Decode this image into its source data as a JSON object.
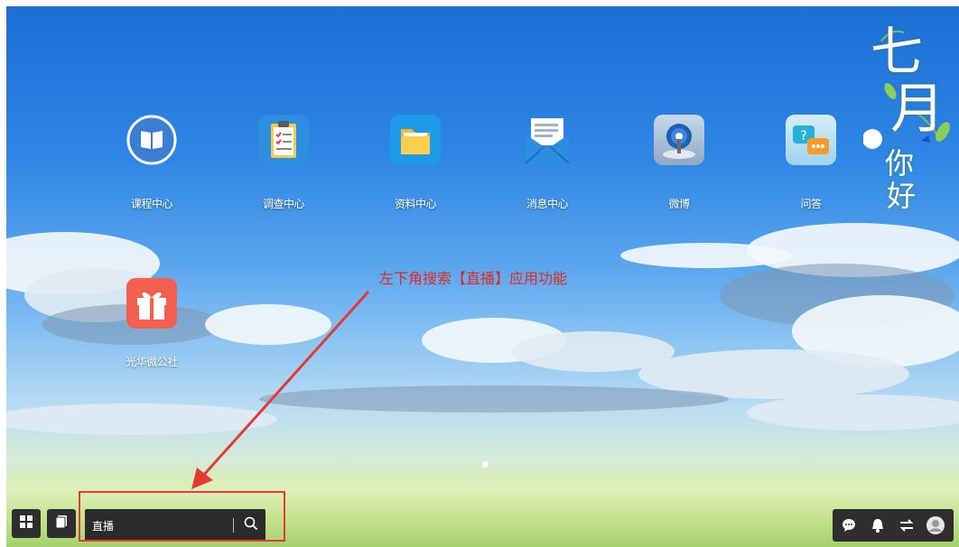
{
  "apps": [
    {
      "label": "课程中心",
      "icon": "book-icon"
    },
    {
      "label": "调查中心",
      "icon": "clipboard-icon"
    },
    {
      "label": "资料中心",
      "icon": "folder-icon"
    },
    {
      "label": "消息中心",
      "icon": "envelope-icon"
    },
    {
      "label": "微博",
      "icon": "broadcast-icon"
    },
    {
      "label": "问答",
      "icon": "qa-bubble-icon"
    },
    {
      "label": "光华微公社",
      "icon": "gift-icon"
    }
  ],
  "decoration": {
    "chars": [
      "七",
      "月",
      "你",
      "好"
    ]
  },
  "annotation": {
    "text": "左下角搜索【直播】应用功能"
  },
  "taskbar": {
    "start_icon": "grid-icon",
    "windows_icon": "windows-icon",
    "search": {
      "value": "直播",
      "icon": "search-icon"
    },
    "tray_icons": [
      "chat-icon",
      "bell-icon",
      "switch-icon",
      "user-icon"
    ]
  },
  "colors": {
    "annotation": "#e02a20",
    "taskbar": "#2b2b2b",
    "highlight": "#e53935"
  }
}
